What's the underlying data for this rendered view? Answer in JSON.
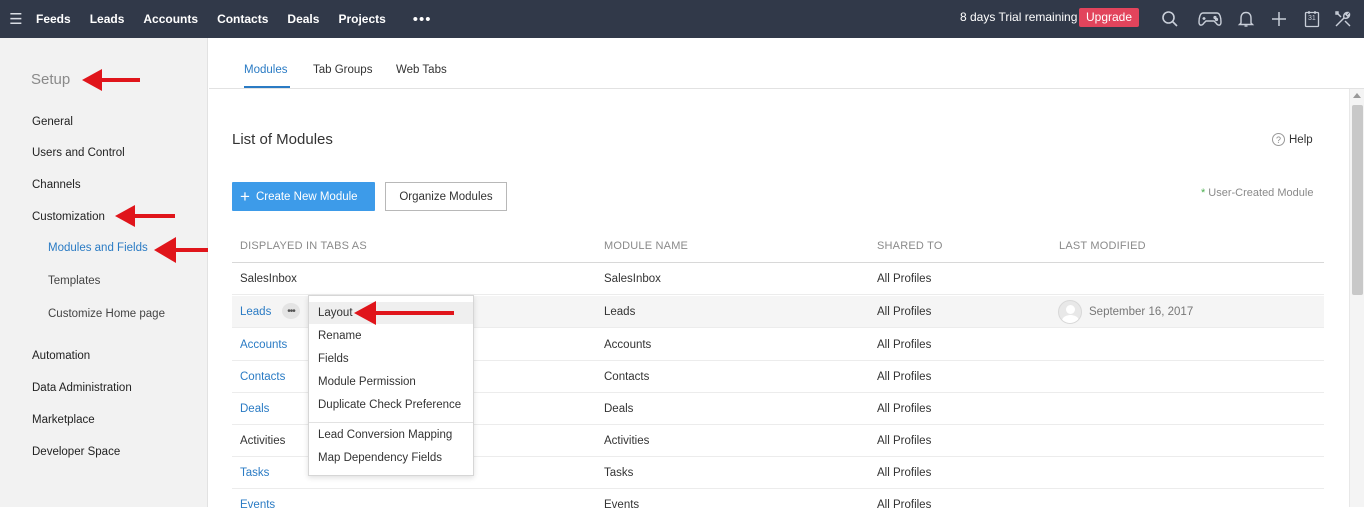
{
  "topnav": {
    "menu_icon": "hamburger-icon",
    "items": [
      "Feeds",
      "Leads",
      "Accounts",
      "Contacts",
      "Deals",
      "Projects"
    ],
    "more": "•••",
    "trial_text": "8 days Trial remaining",
    "upgrade_label": "Upgrade",
    "upgrade_color": "#e2445c",
    "bar_color": "#313949",
    "icons": [
      "search-icon",
      "gamepad-icon",
      "bell-icon",
      "plus-icon",
      "calendar-icon",
      "tools-icon"
    ],
    "calendar_day": "31"
  },
  "sidebar": {
    "title": "Setup",
    "items": [
      "General",
      "Users and Control",
      "Channels",
      "Customization"
    ],
    "customization_sub": [
      "Modules and Fields",
      "Templates",
      "Customize Home page"
    ],
    "items_after": [
      "Automation",
      "Data Administration",
      "Marketplace",
      "Developer Space"
    ]
  },
  "tabs": [
    "Modules",
    "Tab Groups",
    "Web Tabs"
  ],
  "main": {
    "title": "List of Modules",
    "help": "Help",
    "help_icon": "?",
    "create_plus": "+",
    "create_label": "Create New Module",
    "organize_label": "Organize Modules",
    "user_created_star": "*",
    "user_created": "User-Created Module",
    "accent": "#2a7bc4",
    "button_color": "#3d9be9"
  },
  "table": {
    "headers": [
      "DISPLAYED IN TABS AS",
      "MODULE NAME",
      "SHARED TO",
      "LAST MODIFIED"
    ],
    "rows": [
      {
        "tab": "SalesInbox",
        "module": "SalesInbox",
        "shared": "All Profiles",
        "modified": ""
      },
      {
        "tab": "Leads",
        "module": "Leads",
        "shared": "All Profiles",
        "modified": "September 16, 2017"
      },
      {
        "tab": "Accounts",
        "module": "Accounts",
        "shared": "All Profiles",
        "modified": ""
      },
      {
        "tab": "Contacts",
        "module": "Contacts",
        "shared": "All Profiles",
        "modified": ""
      },
      {
        "tab": "Deals",
        "module": "Deals",
        "shared": "All Profiles",
        "modified": ""
      },
      {
        "tab": "Activities",
        "module": "Activities",
        "shared": "All Profiles",
        "modified": ""
      },
      {
        "tab": "Tasks",
        "module": "Tasks",
        "shared": "All Profiles",
        "modified": ""
      },
      {
        "tab": "Events",
        "module": "Events",
        "shared": "All Profiles",
        "modified": ""
      }
    ],
    "row_menu_icon": "•••"
  },
  "menu": {
    "items": [
      "Layout",
      "Rename",
      "Fields",
      "Module Permission",
      "Duplicate Check Preference",
      "Lead Conversion Mapping",
      "Map Dependency Fields"
    ]
  },
  "annotation_color": "#e0151b"
}
